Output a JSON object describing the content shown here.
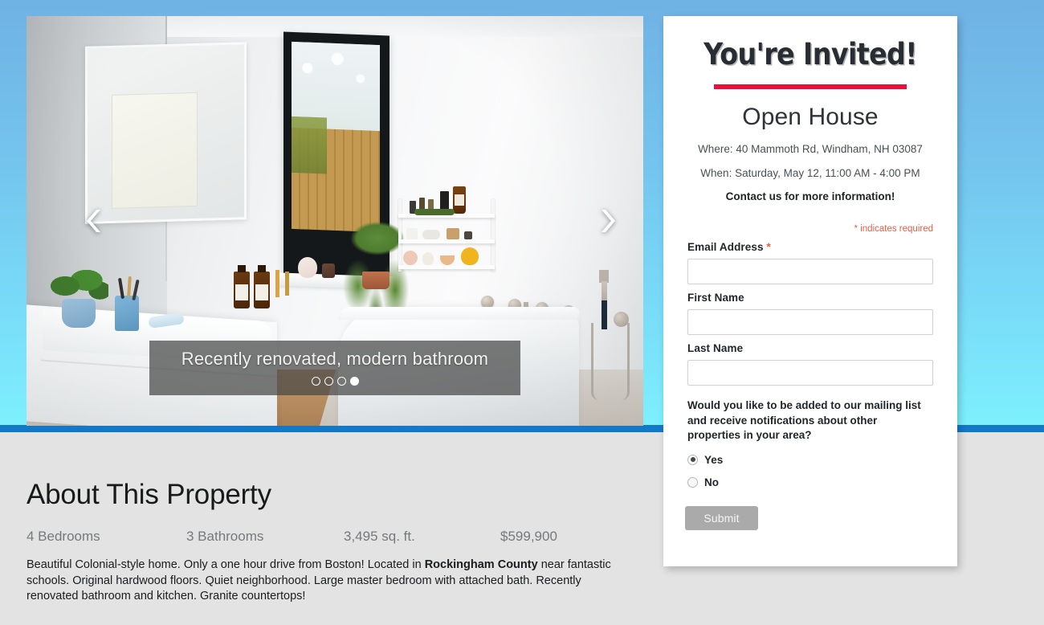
{
  "page": {
    "background_top_color": "#6fb2e4",
    "background_bottom_color": "#7df0fd",
    "divider_color": "#1378c6",
    "lower_background_color": "#e3e3e3"
  },
  "carousel": {
    "caption": "Recently renovated, modern bathroom",
    "prev_label": "Previous slide",
    "next_label": "Next slide",
    "slide_count": 4,
    "active_slide": 4,
    "image_alt": "Recently renovated modern bathroom with freestanding tub, white vanity, black-framed window and wire shelving"
  },
  "signup": {
    "invite_title": "You're Invited!",
    "rule_color": "#ec0e39",
    "event_title": "Open House",
    "where": "Where: 40 Mammoth Rd, Windham, NH 03087",
    "when": "When: Saturday, May 12, 11:00 AM - 4:00 PM",
    "contact": "Contact us for more information!",
    "required_note": "* indicates required",
    "fields": [
      {
        "label": "Email Address ",
        "required_marker": "*",
        "value": "",
        "placeholder": ""
      },
      {
        "label": "First Name",
        "required_marker": "",
        "value": "",
        "placeholder": ""
      },
      {
        "label": "Last Name",
        "required_marker": "",
        "value": "",
        "placeholder": ""
      }
    ],
    "mailing_question": "Would you like to be added to our mailing list and receive notifications about other properties in your area?",
    "radio_options": [
      {
        "label": "Yes",
        "selected": true
      },
      {
        "label": "No",
        "selected": false
      }
    ],
    "submit_label": "Submit",
    "submit_color": "#aaaaaa"
  },
  "about": {
    "title": "About This Property",
    "stats": [
      "4 Bedrooms",
      "3 Bathrooms",
      "3,495 sq. ft.",
      "$599,900"
    ],
    "description_part1": "Beautiful Colonial-style home. Only a one hour drive from Boston! Located in ",
    "description_bold": "Rockingham County",
    "description_part2": " near fantastic schools. Original hardwood floors. Quiet neighborhood. Large master bedroom with attached bath. Recently renovated bathroom and kitchen. Granite countertops!"
  }
}
